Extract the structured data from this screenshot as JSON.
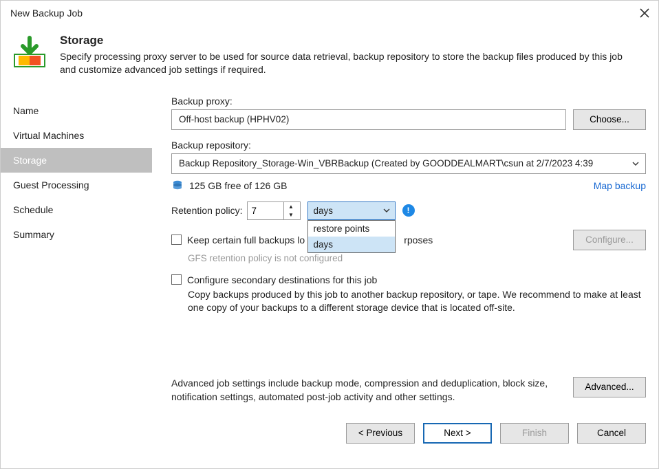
{
  "window": {
    "title": "New Backup Job"
  },
  "header": {
    "title": "Storage",
    "description": "Specify processing proxy server to be used for source data retrieval, backup repository to store the backup files produced by this job and customize advanced job settings if required."
  },
  "sidebar": {
    "items": [
      {
        "label": "Name"
      },
      {
        "label": "Virtual Machines"
      },
      {
        "label": "Storage",
        "selected": true
      },
      {
        "label": "Guest Processing"
      },
      {
        "label": "Schedule"
      },
      {
        "label": "Summary"
      }
    ]
  },
  "main": {
    "proxy_label": "Backup proxy:",
    "proxy_value": "Off-host backup (HPHV02)",
    "choose_btn": "Choose...",
    "repo_label": "Backup repository:",
    "repo_value": "Backup Repository_Storage-Win_VBRBackup (Created by GOODDEALMART\\csun at 2/7/2023 4:39",
    "free_space": "125 GB free of 126 GB",
    "map_link": "Map backup",
    "retention_label": "Retention policy:",
    "retention_value": "7",
    "retention_unit": "days",
    "retention_options": [
      "restore points",
      "days"
    ],
    "keep_full_label": "Keep certain full backups longer for archival purposes",
    "keep_full_visible_fragment": "Keep certain full backups lo",
    "keep_full_visible_tail": "rposes",
    "gfs_note": "GFS retention policy is not configured",
    "configure_btn": "Configure...",
    "secondary_label": "Configure secondary destinations for this job",
    "secondary_desc": "Copy backups produced by this job to another backup repository, or tape. We recommend to make at least one copy of your backups to a different storage device that is located off-site.",
    "advanced_desc": "Advanced job settings include backup mode, compression and deduplication, block size, notification settings, automated post-job activity and other settings.",
    "advanced_btn": "Advanced..."
  },
  "footer": {
    "previous": "< Previous",
    "next": "Next >",
    "finish": "Finish",
    "cancel": "Cancel"
  }
}
